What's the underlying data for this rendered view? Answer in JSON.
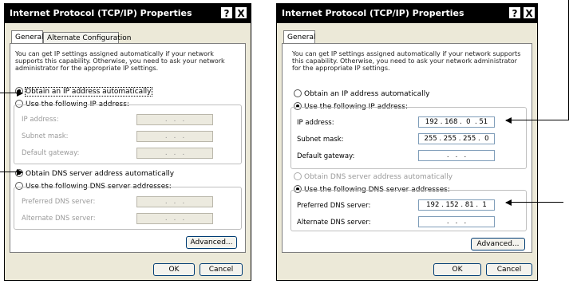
{
  "left_window": {
    "title": "Internet Protocol (TCP/IP) Properties",
    "help_btn": "?",
    "close_btn": "X",
    "tabs": [
      "General",
      "Alternate Configuration"
    ],
    "description": "You can get IP settings assigned automatically if your network supports this capability. Otherwise, you need to ask your network administrator for the appropriate IP settings.",
    "radio_obtain_ip": "Obtain an IP address automatically",
    "radio_use_ip": "Use the following IP address:",
    "ip_label": "IP address:",
    "subnet_label": "Subnet mask:",
    "gateway_label": "Default gateway:",
    "ip_value": " .   .   . ",
    "subnet_value": " .   .   . ",
    "gateway_value": " .   .   . ",
    "radio_obtain_dns": "Obtain DNS server address automatically",
    "radio_use_dns": "Use the following DNS server addresses:",
    "preferred_dns_label": "Preferred DNS server:",
    "alternate_dns_label": "Alternate DNS server:",
    "preferred_dns_value": " .   .   . ",
    "alternate_dns_value": " .   .   . ",
    "advanced_btn": "Advanced...",
    "ok_btn": "OK",
    "cancel_btn": "Cancel"
  },
  "right_window": {
    "title": "Internet Protocol (TCP/IP) Properties",
    "help_btn": "?",
    "close_btn": "X",
    "tabs": [
      "General"
    ],
    "description": "You can get IP settings assigned automatically if your network supports this capability. Otherwise, you need to ask your network administrator for the appropriate IP settings.",
    "radio_obtain_ip": "Obtain an IP address automatically",
    "radio_use_ip": "Use the following IP address:",
    "ip_label": "IP address:",
    "subnet_label": "Subnet mask:",
    "gateway_label": "Default gateway:",
    "ip_value": "192 . 168 .  0  . 51",
    "subnet_value": "255 . 255 . 255 .  0",
    "gateway_value": " .   .   . ",
    "radio_obtain_dns": "Obtain DNS server address automatically",
    "radio_use_dns": "Use the following DNS server addresses:",
    "preferred_dns_label": "Preferred DNS server:",
    "alternate_dns_label": "Alternate DNS server:",
    "preferred_dns_value": "192 . 152 . 81 .  1",
    "alternate_dns_value": " .   .   . ",
    "advanced_btn": "Advanced...",
    "ok_btn": "OK",
    "cancel_btn": "Cancel"
  }
}
